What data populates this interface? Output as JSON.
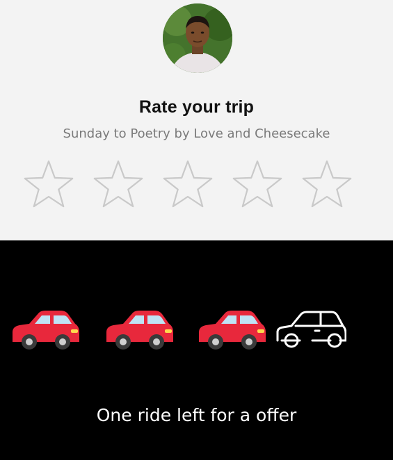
{
  "rating": {
    "title": "Rate your trip",
    "subtitle": "Sunday to Poetry by Love and Cheesecake",
    "stars_total": 5,
    "stars_selected": 0,
    "star_icon": "star-outline-icon",
    "star_color": "#c9c9c9"
  },
  "offer": {
    "message": "One ride left for a offer",
    "rides_completed": 3,
    "rides_total": 4,
    "completed_icon": "red-car-icon",
    "remaining_icon": "car-outline-icon",
    "completed_color": "#e8283c",
    "remaining_color": "#ffffff"
  },
  "colors": {
    "top_background": "#f3f3f3",
    "bottom_background": "#000000"
  }
}
